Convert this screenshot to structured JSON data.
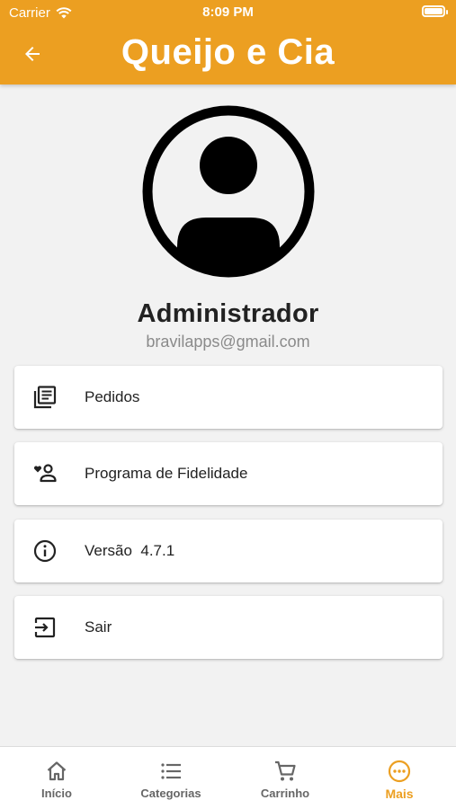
{
  "status_bar": {
    "carrier": "Carrier",
    "time": "8:09 PM"
  },
  "header": {
    "title": "Queijo e Cia",
    "back_icon": "arrow-left-icon"
  },
  "profile": {
    "name": "Administrador",
    "email": "bravilapps@gmail.com",
    "avatar_icon": "account-circle-icon"
  },
  "menu": [
    {
      "label": "Pedidos",
      "icon": "orders-list-icon"
    },
    {
      "label": "Programa de Fidelidade",
      "icon": "loyalty-user-heart-icon"
    },
    {
      "label": "Versão  4.7.1",
      "icon": "info-icon"
    },
    {
      "label": "Sair",
      "icon": "logout-icon"
    }
  ],
  "tabbar": {
    "items": [
      {
        "label": "Início",
        "icon": "home-icon"
      },
      {
        "label": "Categorias",
        "icon": "list-icon"
      },
      {
        "label": "Carrinho",
        "icon": "cart-icon"
      },
      {
        "label": "Mais",
        "icon": "more-circle-icon",
        "active": true
      }
    ]
  },
  "colors": {
    "accent": "#ec9f21",
    "background": "#f2f2f2",
    "text": "#222222",
    "muted": "#8a8a8a"
  }
}
